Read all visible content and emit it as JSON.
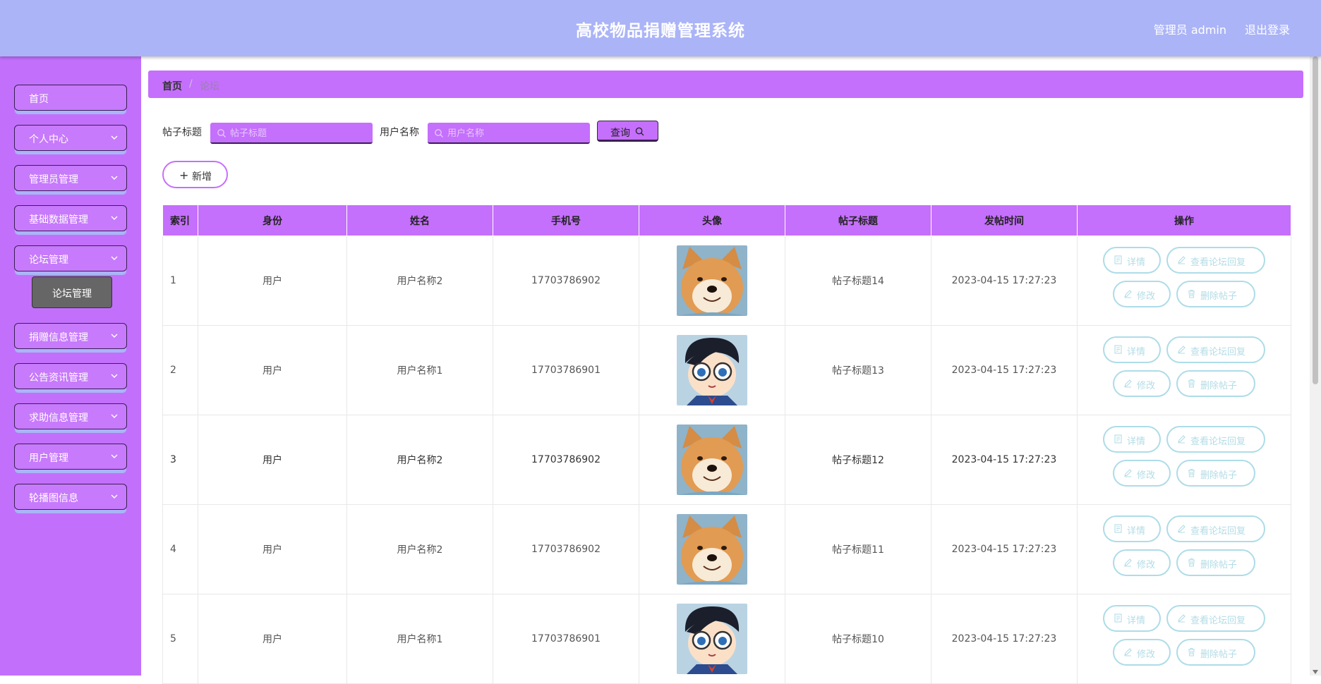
{
  "header": {
    "title": "高校物品捐赠管理系统",
    "user": "管理员 admin",
    "logout": "退出登录"
  },
  "sidebar": {
    "items": [
      {
        "label": "首页"
      },
      {
        "label": "个人中心"
      },
      {
        "label": "管理员管理"
      },
      {
        "label": "基础数据管理"
      },
      {
        "label": "论坛管理"
      },
      {
        "label": "捐赠信息管理"
      },
      {
        "label": "公告资讯管理"
      },
      {
        "label": "求助信息管理"
      },
      {
        "label": "用户管理"
      },
      {
        "label": "轮播图信息"
      }
    ],
    "submenu": {
      "label": "论坛管理"
    }
  },
  "breadcrumb": {
    "home": "首页",
    "separator": "/",
    "current": "论坛"
  },
  "search": {
    "title_label": "帖子标题",
    "title_placeholder": "帖子标题",
    "user_label": "用户名称",
    "user_placeholder": "用户名称",
    "query_button": "查询"
  },
  "add_button": "新增",
  "table": {
    "headers": [
      "索引",
      "身份",
      "姓名",
      "手机号",
      "头像",
      "帖子标题",
      "发帖时间",
      "操作"
    ],
    "rows": [
      {
        "index": "1",
        "role": "用户",
        "name": "用户名称2",
        "phone": "17703786902",
        "avatar": "shiba-dog",
        "title": "帖子标题14",
        "time": "2023-04-15 17:27:23"
      },
      {
        "index": "2",
        "role": "用户",
        "name": "用户名称1",
        "phone": "17703786901",
        "avatar": "cartoon-boy",
        "title": "帖子标题13",
        "time": "2023-04-15 17:27:23"
      },
      {
        "index": "3",
        "role": "用户",
        "name": "用户名称2",
        "phone": "17703786902",
        "avatar": "shiba-dog",
        "title": "帖子标题12",
        "time": "2023-04-15 17:27:23"
      },
      {
        "index": "4",
        "role": "用户",
        "name": "用户名称2",
        "phone": "17703786902",
        "avatar": "shiba-dog",
        "title": "帖子标题11",
        "time": "2023-04-15 17:27:23"
      },
      {
        "index": "5",
        "role": "用户",
        "name": "用户名称1",
        "phone": "17703786901",
        "avatar": "cartoon-boy",
        "title": "帖子标题10",
        "time": "2023-04-15 17:27:23"
      }
    ],
    "actions": {
      "detail": "详情",
      "reply": "查看论坛回复",
      "edit": "修改",
      "delete": "删除帖子"
    }
  },
  "colors": {
    "header": "#abb4f7",
    "sidebar": "#c270fc",
    "accent": "#c56ffd",
    "action_border": "#addce8"
  }
}
